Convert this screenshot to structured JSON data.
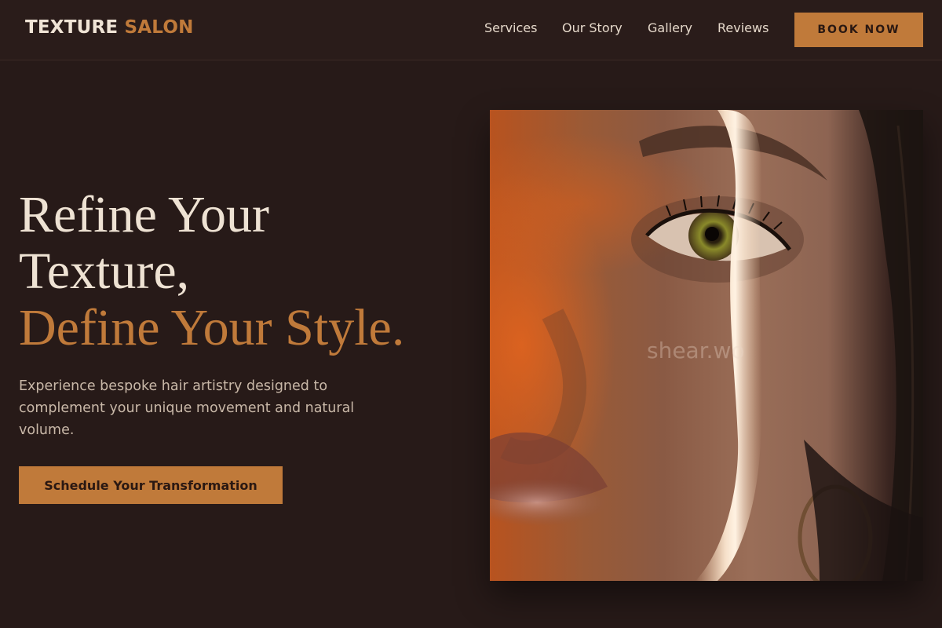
{
  "brand": {
    "name_primary": "TEXTURE",
    "name_accent": "SALON"
  },
  "nav": {
    "links": [
      "Services",
      "Our Story",
      "Gallery",
      "Reviews"
    ],
    "book_label": "BOOK NOW"
  },
  "hero": {
    "title_line1": "Refine Your",
    "title_line2": "Texture,",
    "title_accent": "Define Your Style.",
    "subtitle": "Experience bespoke hair artistry designed to complement your unique movement and natural volume.",
    "cta_label": "Schedule Your Transformation",
    "image_watermark": "shear.wo"
  },
  "colors": {
    "background": "#271a18",
    "accent": "#c07a3a",
    "text_light": "#eee2d3"
  }
}
